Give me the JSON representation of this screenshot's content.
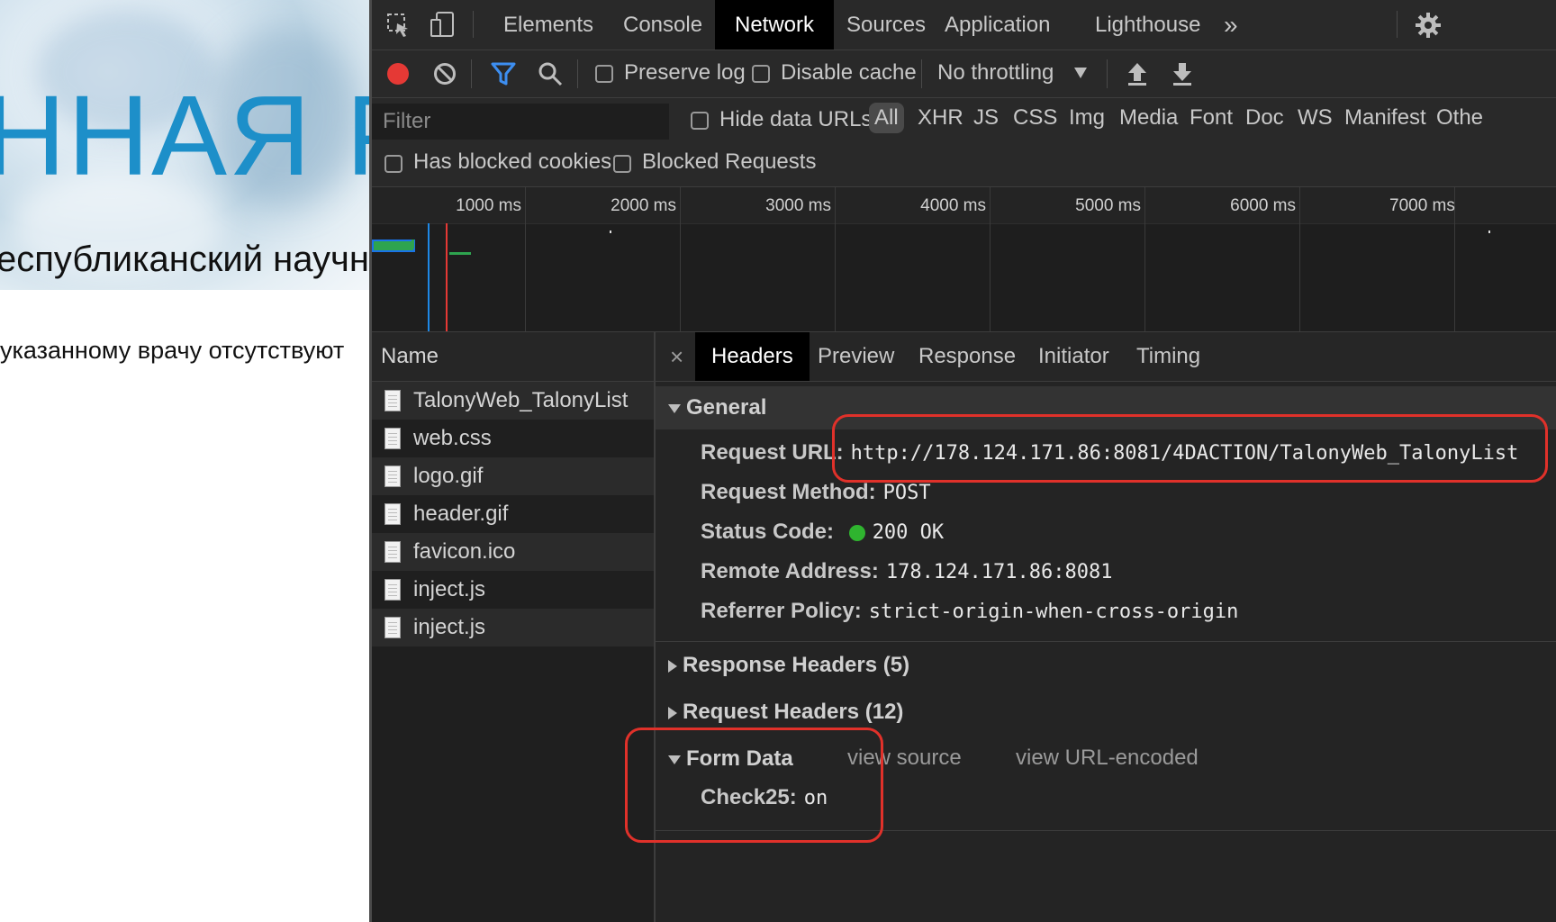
{
  "page": {
    "title_fragment": "ННАЯ Р",
    "subtitle_fragment": "еспубликанский научн",
    "message_fragment": "указанному врачу отсутствуют"
  },
  "devtools": {
    "tabs": [
      "Elements",
      "Console",
      "Network",
      "Sources",
      "Application",
      "Lighthouse"
    ],
    "active_tab": "Network",
    "more_icon": "»",
    "toolbar": {
      "preserve_log": "Preserve log",
      "disable_cache": "Disable cache",
      "throttling": "No throttling"
    },
    "filter": {
      "placeholder": "Filter",
      "hide_data_urls": "Hide data URLs",
      "types": [
        "All",
        "XHR",
        "JS",
        "CSS",
        "Img",
        "Media",
        "Font",
        "Doc",
        "WS",
        "Manifest",
        "Othe"
      ],
      "has_blocked_cookies": "Has blocked cookies",
      "blocked_requests": "Blocked Requests"
    },
    "timeline_ticks": [
      "1000 ms",
      "2000 ms",
      "3000 ms",
      "4000 ms",
      "5000 ms",
      "6000 ms",
      "7000 ms"
    ],
    "requests": {
      "header": "Name",
      "items": [
        "TalonyWeb_TalonyList",
        "web.css",
        "logo.gif",
        "header.gif",
        "favicon.ico",
        "inject.js",
        "inject.js"
      ]
    },
    "detail": {
      "close": "×",
      "tabs": [
        "Headers",
        "Preview",
        "Response",
        "Initiator",
        "Timing"
      ],
      "active_tab": "Headers",
      "general": {
        "title": "General",
        "rows": [
          {
            "key": "Request URL:",
            "value": "http://178.124.171.86:8081/4DACTION/TalonyWeb_TalonyList"
          },
          {
            "key": "Request Method:",
            "value": "POST"
          },
          {
            "key": "Status Code:",
            "value": "200 OK"
          },
          {
            "key": "Remote Address:",
            "value": "178.124.171.86:8081"
          },
          {
            "key": "Referrer Policy:",
            "value": "strict-origin-when-cross-origin"
          }
        ]
      },
      "response_headers": "Response Headers (5)",
      "request_headers": "Request Headers (12)",
      "form_data": {
        "title": "Form Data",
        "view_source": "view source",
        "view_url_encoded": "view URL-encoded",
        "key": "Check25:",
        "value": "on"
      }
    }
  },
  "colors": {
    "status_ok": "#2fb42f",
    "record": "#e53935",
    "filter_active": "#3d8ef0",
    "highlight_box": "#e0312a"
  }
}
